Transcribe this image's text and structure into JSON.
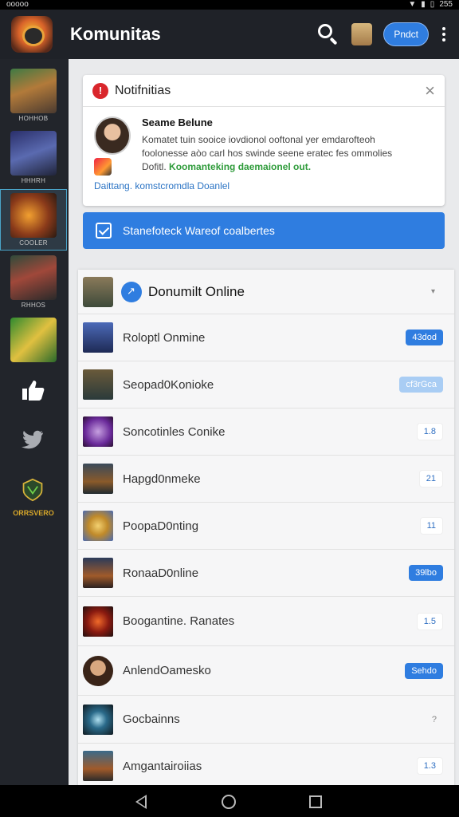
{
  "status_bar": {
    "left_text": "ooooo",
    "right_text": "255"
  },
  "app_bar": {
    "title": "Komunitas",
    "pill_label": "Pndct"
  },
  "sidebar": {
    "items": [
      {
        "label": "HOHHOB"
      },
      {
        "label": "HHHRH"
      },
      {
        "label": "COOLER"
      },
      {
        "label": "RHHOS"
      },
      {
        "label": ""
      }
    ],
    "bottom_label": "ORRSVERO"
  },
  "notification": {
    "title": "Notifnitias",
    "sender": "Seame Belune",
    "message_line1": "Komatet tuin sooice iovdionol ooftonal yer emdarofteoh",
    "message_line2": "foolonesse aòo carl hos swinde seene eratec fes ommolies",
    "message_line3_prefix": "Dofitl.",
    "message_line3_green": "Koomanteking daemaionel out.",
    "footer_link": "Daittang. komstcromdla Doanlel"
  },
  "action_bar": {
    "label": "Stanefoteck Wareof coalbertes"
  },
  "online_panel": {
    "title": "Donumilt Online",
    "rows": [
      {
        "name": "Roloptl Onmine",
        "count": "43dod",
        "style": "pill-blue"
      },
      {
        "name": "Seopad0Konioke",
        "count": "cf3rGca",
        "style": "pill-light"
      },
      {
        "name": "Soncotinles Conike",
        "count": "1.8",
        "style": "plain"
      },
      {
        "name": "Hapgd0nmeke",
        "count": "21",
        "style": "plain"
      },
      {
        "name": "PoopaD0nting",
        "count": "11",
        "style": "plain"
      },
      {
        "name": "RonaaD0nline",
        "count": "39lbo",
        "style": "pill-blue"
      },
      {
        "name": "Boogantine. Ranates",
        "count": "1.5",
        "style": "plain"
      },
      {
        "name": "AnlendOamesko",
        "count": "Sehdo",
        "style": "pill-blue"
      },
      {
        "name": "Gocbainns",
        "count": "?",
        "style": "bare"
      },
      {
        "name": "Amgantairoiias",
        "count": "1.3",
        "style": "plain"
      }
    ]
  }
}
